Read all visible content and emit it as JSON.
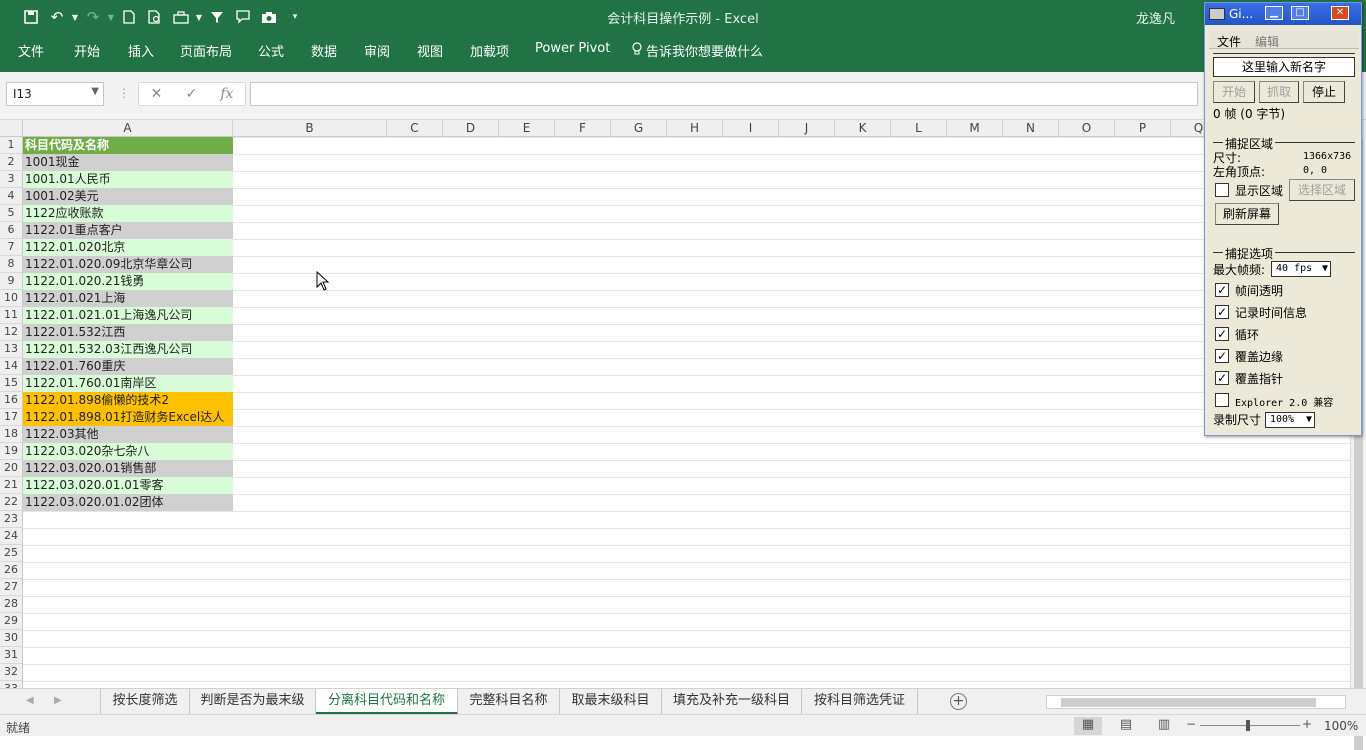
{
  "window": {
    "title": "会计科目操作示例 - Excel",
    "user": "龙逸凡"
  },
  "ribbon_tabs": [
    "文件",
    "开始",
    "插入",
    "页面布局",
    "公式",
    "数据",
    "审阅",
    "视图",
    "加载项",
    "Power Pivot"
  ],
  "tell_me": "告诉我你想要做什么",
  "formula_bar": {
    "name_box": "I13",
    "fx_label": "fx",
    "value": ""
  },
  "columns": [
    "A",
    "B",
    "C",
    "D",
    "E",
    "F",
    "G",
    "H",
    "I",
    "J",
    "K",
    "L",
    "M",
    "N",
    "O",
    "P",
    "Q"
  ],
  "rows": [
    {
      "n": "1",
      "text": "科目代码及名称",
      "style": "header"
    },
    {
      "n": "2",
      "text": "1001现金",
      "style": "grey"
    },
    {
      "n": "3",
      "text": "1001.01人民币",
      "style": "green"
    },
    {
      "n": "4",
      "text": "1001.02美元",
      "style": "grey"
    },
    {
      "n": "5",
      "text": "1122应收账款",
      "style": "green"
    },
    {
      "n": "6",
      "text": "1122.01重点客户",
      "style": "grey"
    },
    {
      "n": "7",
      "text": "1122.01.020北京",
      "style": "green"
    },
    {
      "n": "8",
      "text": "1122.01.020.09北京华章公司",
      "style": "grey"
    },
    {
      "n": "9",
      "text": "1122.01.020.21钱勇",
      "style": "green"
    },
    {
      "n": "10",
      "text": "1122.01.021上海",
      "style": "grey"
    },
    {
      "n": "11",
      "text": "1122.01.021.01上海逸凡公司",
      "style": "green"
    },
    {
      "n": "12",
      "text": "1122.01.532江西",
      "style": "grey"
    },
    {
      "n": "13",
      "text": "1122.01.532.03江西逸凡公司",
      "style": "green"
    },
    {
      "n": "14",
      "text": "1122.01.760重庆",
      "style": "grey"
    },
    {
      "n": "15",
      "text": "1122.01.760.01南岸区",
      "style": "green"
    },
    {
      "n": "16",
      "text": "1122.01.898偷懒的技术2",
      "style": "orange"
    },
    {
      "n": "17",
      "text": "1122.01.898.01打造财务Excel达人",
      "style": "orange"
    },
    {
      "n": "18",
      "text": "1122.03其他",
      "style": "grey"
    },
    {
      "n": "19",
      "text": "1122.03.020杂七杂八",
      "style": "green"
    },
    {
      "n": "20",
      "text": "1122.03.020.01销售部",
      "style": "grey"
    },
    {
      "n": "21",
      "text": "1122.03.020.01.01零客",
      "style": "green"
    },
    {
      "n": "22",
      "text": "1122.03.020.01.02团体",
      "style": "grey"
    },
    {
      "n": "23",
      "text": "",
      "style": ""
    },
    {
      "n": "24",
      "text": "",
      "style": ""
    },
    {
      "n": "25",
      "text": "",
      "style": ""
    },
    {
      "n": "26",
      "text": "",
      "style": ""
    },
    {
      "n": "27",
      "text": "",
      "style": ""
    },
    {
      "n": "28",
      "text": "",
      "style": ""
    },
    {
      "n": "29",
      "text": "",
      "style": ""
    },
    {
      "n": "30",
      "text": "",
      "style": ""
    },
    {
      "n": "31",
      "text": "",
      "style": ""
    },
    {
      "n": "32",
      "text": "",
      "style": ""
    },
    {
      "n": "33",
      "text": "",
      "style": ""
    }
  ],
  "sheet_tabs": [
    {
      "label": "按长度筛选",
      "active": false
    },
    {
      "label": "判断是否为最末级",
      "active": false
    },
    {
      "label": "分离科目代码和名称",
      "active": true
    },
    {
      "label": "完整科目名称",
      "active": false
    },
    {
      "label": "取最末级科目",
      "active": false
    },
    {
      "label": "填充及补充一级科目",
      "active": false
    },
    {
      "label": "按科目筛选凭证",
      "active": false
    }
  ],
  "status": {
    "ready": "就绪",
    "zoom": "100%"
  },
  "gif_recorder": {
    "title": "Gi...",
    "menu": [
      "文件",
      "编辑"
    ],
    "name_input": "这里输入新名字",
    "buttons": {
      "start": "开始",
      "capture": "抓取",
      "stop": "停止"
    },
    "frames": "0 帧 (0 字节)",
    "capture_area_title": "捕捉区域",
    "size_label": "尺寸:",
    "size_value": "1366x736",
    "origin_label": "左角顶点:",
    "origin_value": "0, 0",
    "show_area": "显示区域",
    "select_area": "选择区域",
    "refresh": "刷新屏幕",
    "options_title": "捕捉选项",
    "max_fps_label": "最大帧频:",
    "max_fps": "40 fps",
    "options": [
      {
        "label": "帧间透明",
        "checked": true
      },
      {
        "label": "记录时间信息",
        "checked": true
      },
      {
        "label": "循环",
        "checked": true
      },
      {
        "label": "覆盖边缘",
        "checked": true
      },
      {
        "label": "覆盖指针",
        "checked": true
      },
      {
        "label": "Explorer 2.0 兼容",
        "checked": false
      }
    ],
    "record_size_label": "录制尺寸",
    "record_size": "100%"
  }
}
